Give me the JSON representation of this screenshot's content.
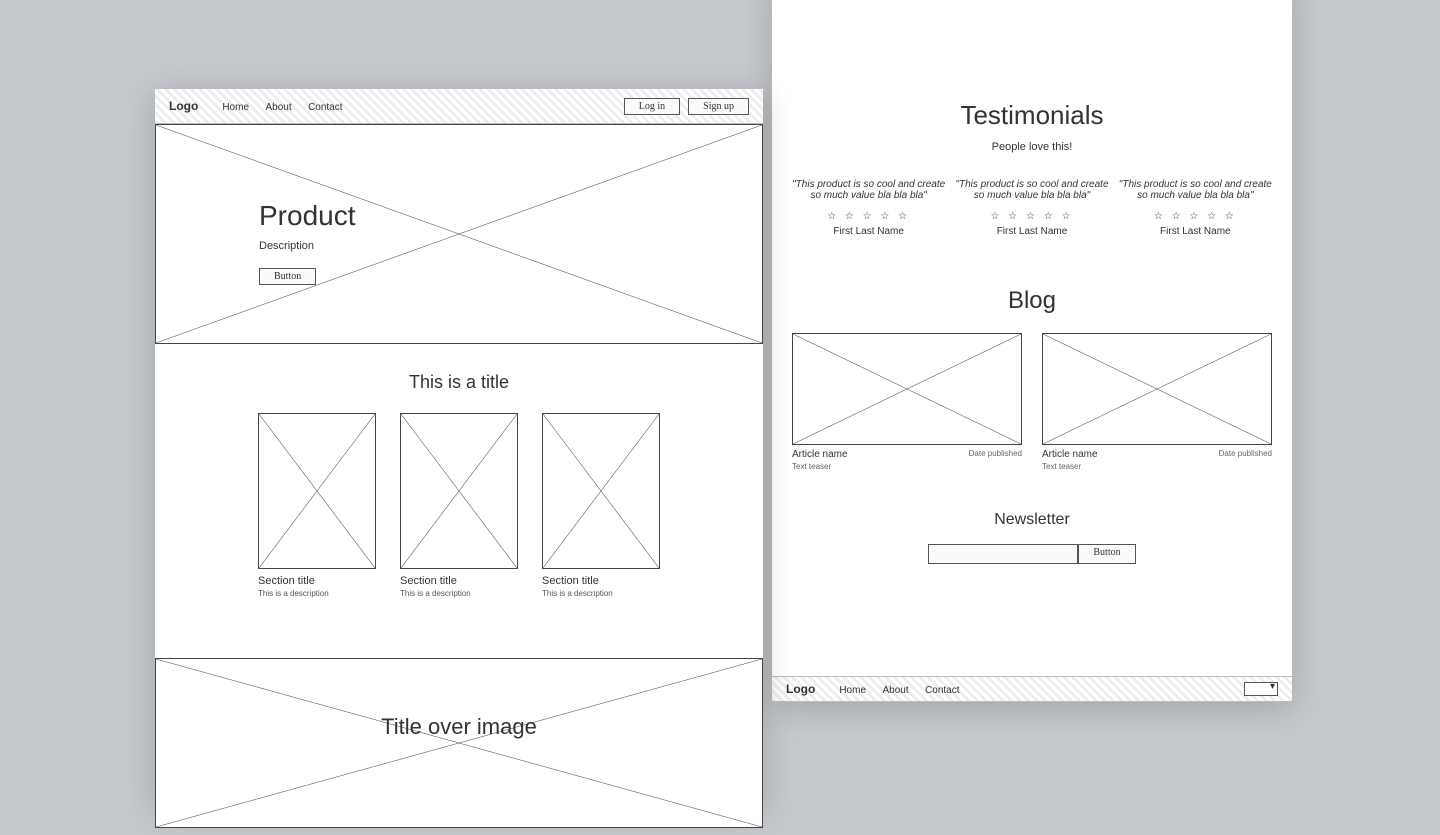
{
  "left": {
    "header": {
      "logo": "Logo",
      "nav": [
        "Home",
        "About",
        "Contact"
      ],
      "login": "Log in",
      "signup": "Sign up"
    },
    "hero": {
      "title": "Product",
      "desc": "Description",
      "cta": "Button"
    },
    "features": {
      "title": "This is a title",
      "cards": [
        {
          "title": "Section title",
          "desc": "This is a description"
        },
        {
          "title": "Section title",
          "desc": "This is a description"
        },
        {
          "title": "Section title",
          "desc": "This is a description"
        }
      ]
    },
    "overlay_title": "Title over image"
  },
  "right": {
    "testimonials": {
      "title": "Testimonials",
      "subtitle": "People love this!",
      "items": [
        {
          "quote": "\"This product is so cool and create so much value bla bla bla\"",
          "author": "First Last Name"
        },
        {
          "quote": "\"This product is so cool and create so much value bla bla bla\"",
          "author": "First Last Name"
        },
        {
          "quote": "\"This product is so cool and create so much value bla bla bla\"",
          "author": "First Last Name"
        }
      ],
      "stars": "☆ ☆ ☆ ☆ ☆"
    },
    "blog": {
      "title": "Blog",
      "posts": [
        {
          "title": "Article name",
          "date": "Date published",
          "teaser": "Text teaser"
        },
        {
          "title": "Article name",
          "date": "Date published",
          "teaser": "Text teaser"
        }
      ]
    },
    "newsletter": {
      "title": "Newsletter",
      "button": "Button",
      "placeholder": ""
    },
    "footer": {
      "logo": "Logo",
      "nav": [
        "Home",
        "About",
        "Contact"
      ]
    }
  }
}
